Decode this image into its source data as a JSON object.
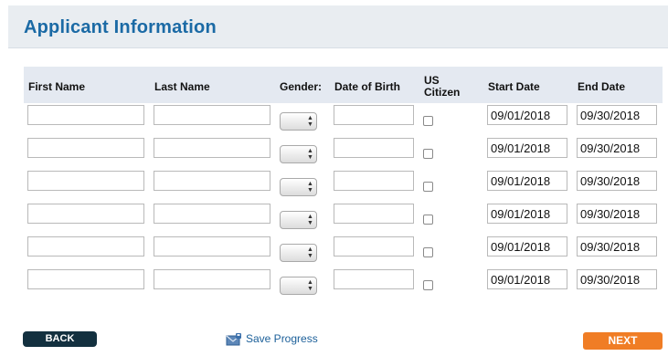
{
  "page": {
    "title": "Applicant Information"
  },
  "table": {
    "columns": {
      "first_name": "First Name",
      "last_name": "Last Name",
      "gender": "Gender:",
      "dob": "Date of Birth",
      "us_citizen_line1": "US",
      "us_citizen_line2": "Citizen",
      "start_date": "Start Date",
      "end_date": "End Date"
    },
    "rows": [
      {
        "first_name": "",
        "last_name": "",
        "dob": "",
        "us_citizen": false,
        "start_date": "09/01/2018",
        "end_date": "09/30/2018"
      },
      {
        "first_name": "",
        "last_name": "",
        "dob": "",
        "us_citizen": false,
        "start_date": "09/01/2018",
        "end_date": "09/30/2018"
      },
      {
        "first_name": "",
        "last_name": "",
        "dob": "",
        "us_citizen": false,
        "start_date": "09/01/2018",
        "end_date": "09/30/2018"
      },
      {
        "first_name": "",
        "last_name": "",
        "dob": "",
        "us_citizen": false,
        "start_date": "09/01/2018",
        "end_date": "09/30/2018"
      },
      {
        "first_name": "",
        "last_name": "",
        "dob": "",
        "us_citizen": false,
        "start_date": "09/01/2018",
        "end_date": "09/30/2018"
      },
      {
        "first_name": "",
        "last_name": "",
        "dob": "",
        "us_citizen": false,
        "start_date": "09/01/2018",
        "end_date": "09/30/2018"
      }
    ]
  },
  "footer": {
    "back_label": "BACK",
    "save_progress_label": "Save Progress",
    "save_icon": "envelope-save-icon",
    "next_label": "NEXT"
  },
  "colors": {
    "title_blue": "#1b6aa5",
    "back_button": "#13303f",
    "next_button": "#f07d25",
    "header_band": "#e9edf1",
    "table_header": "#e4e9f1"
  }
}
